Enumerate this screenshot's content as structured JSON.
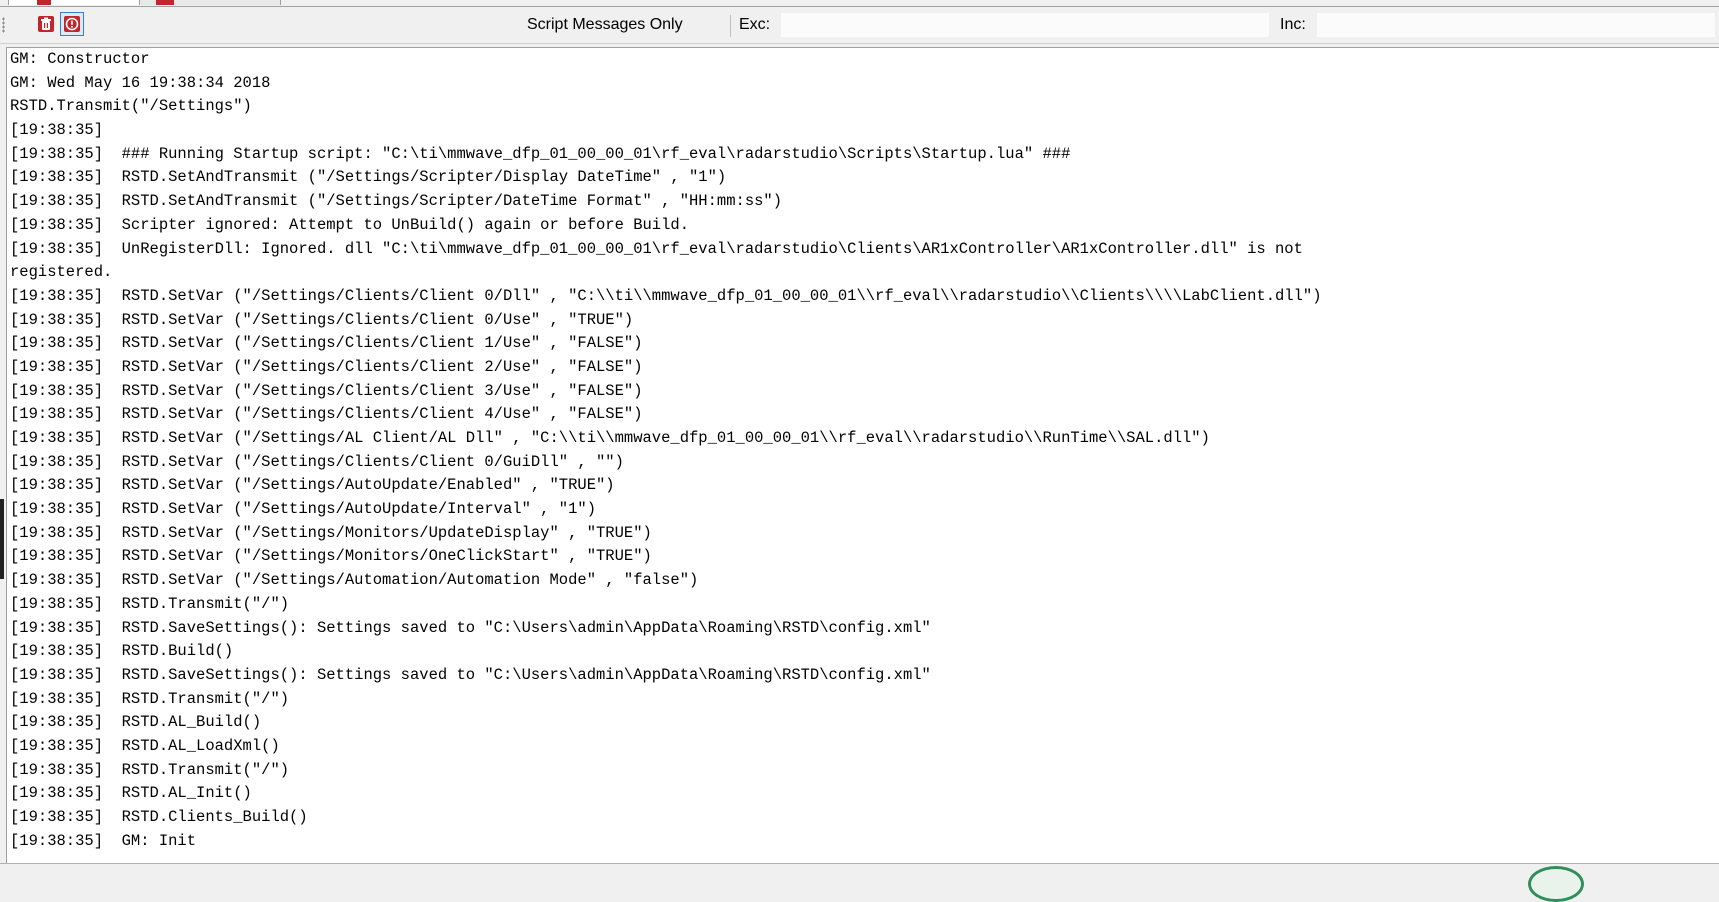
{
  "toolbar": {
    "filter_label": "Script Messages Only",
    "exc_label": "Exc:",
    "exc_value": "",
    "inc_label": "Inc:",
    "inc_value": "",
    "icons": [
      "clear-log-icon",
      "info-icon"
    ]
  },
  "log": {
    "lines": [
      "GM: Constructor",
      "GM: Wed May 16 19:38:34 2018",
      "RSTD.Transmit(\"/Settings\")",
      "[19:38:35]",
      "[19:38:35]  ### Running Startup script: \"C:\\ti\\mmwave_dfp_01_00_00_01\\rf_eval\\radarstudio\\Scripts\\Startup.lua\" ###",
      "[19:38:35]  RSTD.SetAndTransmit (\"/Settings/Scripter/Display DateTime\" , \"1\")",
      "[19:38:35]  RSTD.SetAndTransmit (\"/Settings/Scripter/DateTime Format\" , \"HH:mm:ss\")",
      "[19:38:35]  Scripter ignored: Attempt to UnBuild() again or before Build.",
      "[19:38:35]  UnRegisterDll: Ignored. dll \"C:\\ti\\mmwave_dfp_01_00_00_01\\rf_eval\\radarstudio\\Clients\\AR1xController\\AR1xController.dll\" is not",
      "registered.",
      "[19:38:35]  RSTD.SetVar (\"/Settings/Clients/Client 0/Dll\" , \"C:\\\\ti\\\\mmwave_dfp_01_00_00_01\\\\rf_eval\\\\radarstudio\\\\Clients\\\\\\\\LabClient.dll\")",
      "[19:38:35]  RSTD.SetVar (\"/Settings/Clients/Client 0/Use\" , \"TRUE\")",
      "[19:38:35]  RSTD.SetVar (\"/Settings/Clients/Client 1/Use\" , \"FALSE\")",
      "[19:38:35]  RSTD.SetVar (\"/Settings/Clients/Client 2/Use\" , \"FALSE\")",
      "[19:38:35]  RSTD.SetVar (\"/Settings/Clients/Client 3/Use\" , \"FALSE\")",
      "[19:38:35]  RSTD.SetVar (\"/Settings/Clients/Client 4/Use\" , \"FALSE\")",
      "[19:38:35]  RSTD.SetVar (\"/Settings/AL Client/AL Dll\" , \"C:\\\\ti\\\\mmwave_dfp_01_00_00_01\\\\rf_eval\\\\radarstudio\\\\RunTime\\\\SAL.dll\")",
      "[19:38:35]  RSTD.SetVar (\"/Settings/Clients/Client 0/GuiDll\" , \"\")",
      "[19:38:35]  RSTD.SetVar (\"/Settings/AutoUpdate/Enabled\" , \"TRUE\")",
      "[19:38:35]  RSTD.SetVar (\"/Settings/AutoUpdate/Interval\" , \"1\")",
      "[19:38:35]  RSTD.SetVar (\"/Settings/Monitors/UpdateDisplay\" , \"TRUE\")",
      "[19:38:35]  RSTD.SetVar (\"/Settings/Monitors/OneClickStart\" , \"TRUE\")",
      "[19:38:35]  RSTD.SetVar (\"/Settings/Automation/Automation Mode\" , \"false\")",
      "[19:38:35]  RSTD.Transmit(\"/\")",
      "[19:38:35]  RSTD.SaveSettings(): Settings saved to \"C:\\Users\\admin\\AppData\\Roaming\\RSTD\\config.xml\"",
      "[19:38:35]  RSTD.Build()",
      "[19:38:35]  RSTD.SaveSettings(): Settings saved to \"C:\\Users\\admin\\AppData\\Roaming\\RSTD\\config.xml\"",
      "[19:38:35]  RSTD.Transmit(\"/\")",
      "[19:38:35]  RSTD.AL_Build()",
      "[19:38:35]  RSTD.AL_LoadXml()",
      "[19:38:35]  RSTD.Transmit(\"/\")",
      "[19:38:35]  RSTD.AL_Init()",
      "[19:38:35]  RSTD.Clients_Build()",
      "[19:38:35]  GM: Init"
    ]
  },
  "colors": {
    "accent_red": "#c0262c",
    "info_border": "#3d7ecb"
  }
}
